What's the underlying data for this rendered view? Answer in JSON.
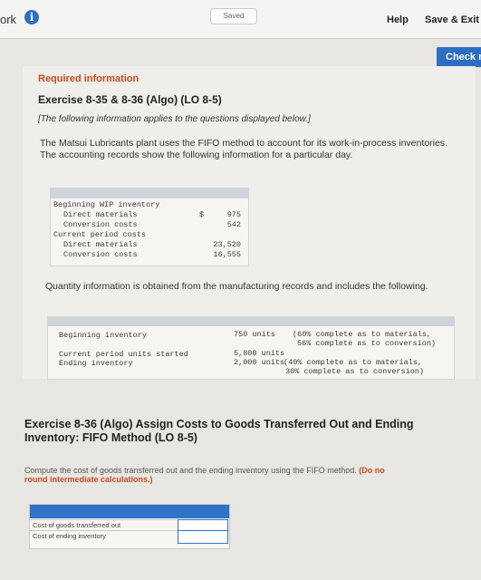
{
  "header": {
    "work_label": "ork",
    "saved_label": "Saved",
    "help_label": "Help",
    "save_exit_label": "Save & Exit",
    "check_label": "Check m"
  },
  "content": {
    "required_info": "Required information",
    "exercise_title": "Exercise 8-35 & 8-36 (Algo) (LO 8-5)",
    "applies_note": "[The following information applies to the questions displayed below.]",
    "intro_paragraph": "The Matsui Lubricants plant uses the FIFO method to account for its work-in-process inventories. The accounting records show the following information for a particular day.",
    "cost_table": {
      "beginning_wip": "Beginning WIP inventory",
      "direct_materials_1": "Direct materials",
      "conversion_costs_1": "Conversion costs",
      "current_period_costs": "Current period costs",
      "direct_materials_2": "Direct materials",
      "conversion_costs_2": "Conversion costs",
      "currency": "$",
      "dm_begin": "975",
      "cc_begin": "542",
      "dm_current": "23,520",
      "cc_current": "16,555"
    },
    "quantity_paragraph": "Quantity information is obtained from the manufacturing records and includes the following.",
    "qty_table": {
      "beginning_inventory": "Beginning inventory",
      "beginning_units": "750 units",
      "beginning_note_1": "(60% complete as to materials,",
      "beginning_note_2": "56% complete as to conversion)",
      "current_started": "Current period units started",
      "ending_inventory": "Ending inventory",
      "started_units": "5,800 units",
      "ending_units": "2,000 units",
      "ending_note_1": "(40% complete as to materials,",
      "ending_note_2": "30% complete as to conversion)"
    },
    "exercise_36_title": "Exercise 8-36 (Algo) Assign Costs to Goods Transferred Out and Ending Inventory: FIFO Method (LO 8-5)",
    "compute_text": "Compute the cost of goods transferred out and the ending inventory using the FIFO method.",
    "compute_bold_1": "(Do no",
    "compute_bold_2": "round intermediate calculations.)",
    "answer_rows": [
      "Cost of goods transferred out",
      "Cost of ending inventory"
    ],
    "answer_values": [
      "",
      ""
    ]
  }
}
